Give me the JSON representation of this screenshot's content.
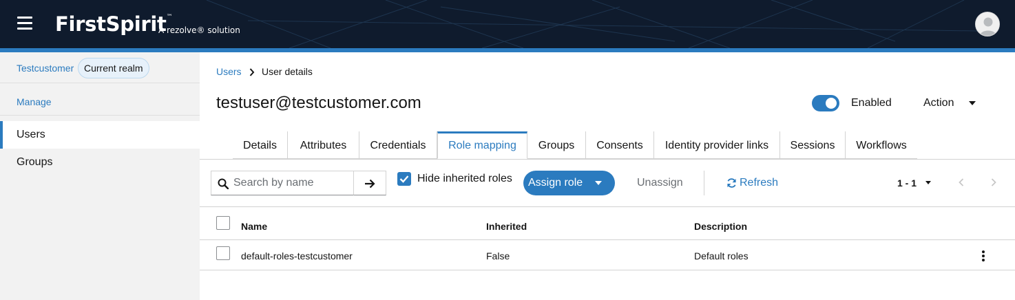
{
  "header": {
    "brand": "FirstSpirit",
    "brand_mark": "™",
    "tagline": "A rezolve® solution"
  },
  "sidebar": {
    "realm_name": "Testcustomer",
    "realm_badge": "Current realm",
    "section": "Manage",
    "items": [
      {
        "label": "Users",
        "active": true
      },
      {
        "label": "Groups",
        "active": false
      }
    ]
  },
  "breadcrumb": {
    "parent": "Users",
    "current": "User details"
  },
  "page": {
    "title": "testuser@testcustomer.com",
    "enabled_label": "Enabled",
    "enabled": true,
    "action_label": "Action"
  },
  "tabs": [
    {
      "label": "Details"
    },
    {
      "label": "Attributes"
    },
    {
      "label": "Credentials"
    },
    {
      "label": "Role mapping",
      "active": true
    },
    {
      "label": "Groups"
    },
    {
      "label": "Consents"
    },
    {
      "label": "Identity provider links"
    },
    {
      "label": "Sessions"
    },
    {
      "label": "Workflows"
    }
  ],
  "toolbar": {
    "search_placeholder": "Search by name",
    "hide_inherited_label": "Hide inherited roles",
    "hide_inherited_checked": true,
    "assign_label": "Assign role",
    "unassign_label": "Unassign",
    "refresh_label": "Refresh",
    "pagination": "1 - 1"
  },
  "table": {
    "columns": [
      "Name",
      "Inherited",
      "Description"
    ],
    "rows": [
      {
        "name": "default-roles-testcustomer",
        "inherited": "False",
        "description": "Default roles"
      }
    ]
  },
  "colors": {
    "header_bg": "#0f1b2d",
    "accent": "#2b7bbf",
    "sidebar_bg": "#f2f2f2"
  },
  "icons": [
    "hamburger-icon",
    "avatar-icon",
    "search-icon",
    "arrow-right-icon",
    "caret-down-icon",
    "refresh-icon",
    "chevron-left-icon",
    "chevron-right-icon",
    "kebab-icon"
  ]
}
